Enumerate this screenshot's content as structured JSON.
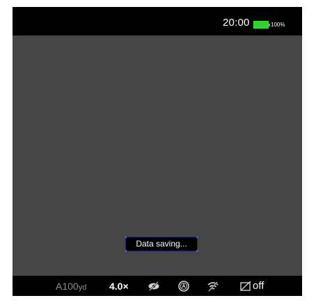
{
  "status_bar": {
    "time": "20:00",
    "battery_percent": "100%",
    "battery_level": 1.0,
    "battery_color": "#2fd12f",
    "battery_icon": "battery-full-icon"
  },
  "viewport": {
    "background_color": "#464646"
  },
  "toast": {
    "message": "Data saving..."
  },
  "bottom_bar": {
    "range_value": "A100",
    "range_unit": "yd",
    "zoom": "4.0×",
    "icons": [
      "eye-off-icon",
      "auto-mode-icon",
      "wifi-off-icon",
      "record-off-icon"
    ],
    "record_state": "off"
  }
}
